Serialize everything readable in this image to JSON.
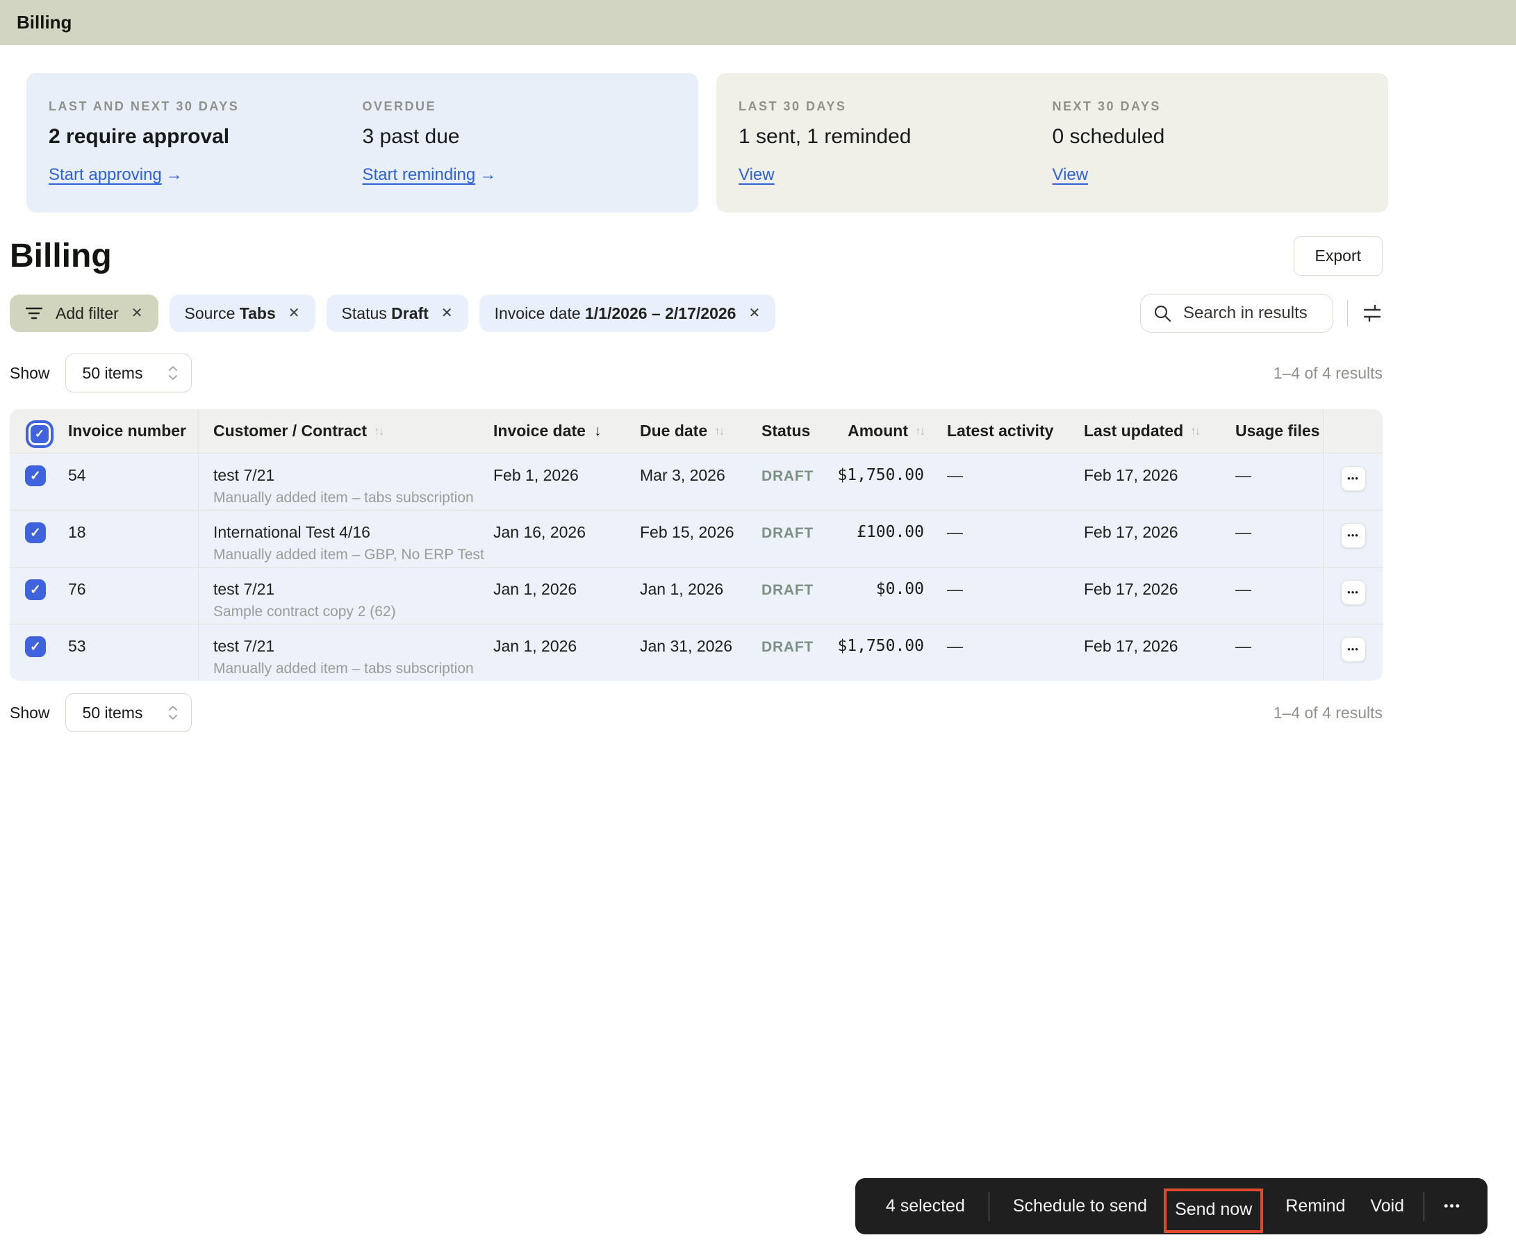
{
  "topbar": {
    "title": "Billing"
  },
  "summary": {
    "cards": [
      {
        "stats": [
          {
            "label": "LAST AND NEXT 30 DAYS",
            "value": "2 require approval",
            "link": "Start approving",
            "arrow": "→"
          },
          {
            "label": "OVERDUE",
            "value": "3 past due",
            "link": "Start reminding",
            "arrow": "→"
          }
        ]
      },
      {
        "stats": [
          {
            "label": "LAST 30 DAYS",
            "value": "1 sent, 1 reminded",
            "link": "View"
          },
          {
            "label": "NEXT 30 DAYS",
            "value": "0 scheduled",
            "link": "View"
          }
        ]
      }
    ]
  },
  "header": {
    "title": "Billing",
    "export_label": "Export"
  },
  "filters": {
    "add_filter_label": "Add filter",
    "pills": [
      {
        "prefix": "Source",
        "value": "Tabs"
      },
      {
        "prefix": "Status",
        "value": "Draft"
      },
      {
        "prefix": "Invoice date",
        "value": "1/1/2026 – 2/17/2026"
      }
    ],
    "search_placeholder": "Search in results"
  },
  "pagination": {
    "show_label": "Show",
    "page_size": "50 items",
    "results": "1–4 of 4 results"
  },
  "table": {
    "columns": [
      {
        "label": "Invoice number"
      },
      {
        "label": "Customer / Contract",
        "sort": "both"
      },
      {
        "label": "Invoice date",
        "sort": "desc"
      },
      {
        "label": "Due date",
        "sort": "both"
      },
      {
        "label": "Status"
      },
      {
        "label": "Amount",
        "sort": "both"
      },
      {
        "label": "Latest activity"
      },
      {
        "label": "Last updated",
        "sort": "both"
      },
      {
        "label": "Usage files"
      }
    ],
    "rows": [
      {
        "invoice_number": "54",
        "customer": "test 7/21",
        "contract": "Manually added item – tabs subscription",
        "invoice_date": "Feb 1, 2026",
        "due_date": "Mar 3, 2026",
        "status": "DRAFT",
        "amount": "$1,750.00",
        "latest_activity": "—",
        "last_updated": "Feb 17, 2026",
        "usage_files": "—"
      },
      {
        "invoice_number": "18",
        "customer": "International Test 4/16",
        "contract": "Manually added item – GBP, No ERP Test",
        "invoice_date": "Jan 16, 2026",
        "due_date": "Feb 15, 2026",
        "status": "DRAFT",
        "amount": "£100.00",
        "latest_activity": "—",
        "last_updated": "Feb 17, 2026",
        "usage_files": "—"
      },
      {
        "invoice_number": "76",
        "customer": "test 7/21",
        "contract": "Sample contract copy 2 (62)",
        "invoice_date": "Jan 1, 2026",
        "due_date": "Jan 1, 2026",
        "status": "DRAFT",
        "amount": "$0.00",
        "latest_activity": "—",
        "last_updated": "Feb 17, 2026",
        "usage_files": "—"
      },
      {
        "invoice_number": "53",
        "customer": "test 7/21",
        "contract": "Manually added item – tabs subscription",
        "invoice_date": "Jan 1, 2026",
        "due_date": "Jan 31, 2026",
        "status": "DRAFT",
        "amount": "$1,750.00",
        "latest_activity": "—",
        "last_updated": "Feb 17, 2026",
        "usage_files": "—"
      }
    ]
  },
  "toolbar": {
    "selected_label": "4 selected",
    "schedule_label": "Schedule to send",
    "send_now_label": "Send now",
    "remind_label": "Remind",
    "void_label": "Void",
    "more_glyph": "•••"
  },
  "icons": {
    "check": "✓",
    "close": "✕",
    "sort_both": "↑↓",
    "sort_desc": "↓",
    "dots": "•••"
  },
  "colors": {
    "topbar_bg": "#d2d5c2",
    "card_blue": "#e9eff9",
    "card_beige": "#f0efe8",
    "link_blue": "#2e62d9",
    "checkbox_blue": "#3e63dd",
    "row_bg": "#edf2fa",
    "header_bg": "#f0f0ee",
    "status_draft": "#7d9183",
    "toolbar_bg": "#1e1f1e",
    "highlight_red": "#e04a2e",
    "add_filter_bg": "#d1d5bd"
  }
}
